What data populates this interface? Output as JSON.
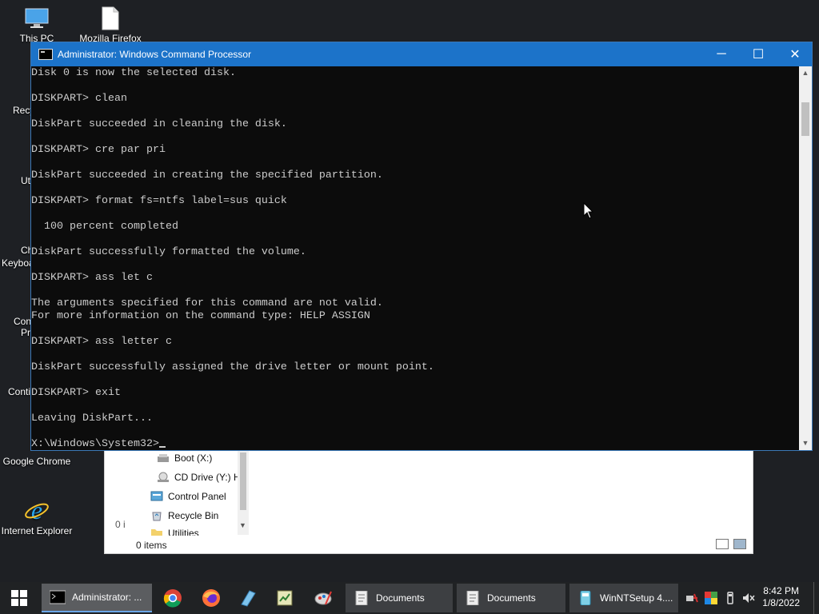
{
  "desktop": {
    "icons": [
      {
        "label": "This PC",
        "icon": "this-pc-icon"
      },
      {
        "label": "Mozilla Firefox",
        "icon": "file-icon"
      },
      {
        "label": "Google Chrome",
        "icon": "chrome-icon"
      },
      {
        "label": "Internet Explorer",
        "icon": "ie-icon"
      }
    ],
    "partial_labels": [
      "Recy",
      "Ut",
      "Ch",
      "Keyboa",
      "Con",
      "Pr",
      "Conti"
    ]
  },
  "explorer": {
    "nav_items": [
      {
        "label": "Boot (X:)",
        "icon": "drive-icon"
      },
      {
        "label": "CD Drive (Y:) H",
        "icon": "cd-drive-icon"
      },
      {
        "label": "Control Panel",
        "icon": "control-panel-icon"
      },
      {
        "label": "Recycle Bin",
        "icon": "recycle-bin-icon"
      },
      {
        "label": "Utilities",
        "icon": "folder-icon"
      }
    ],
    "left_hint": "0 i",
    "status": "0 items"
  },
  "console": {
    "title": "Administrator: Windows Command Processor",
    "lines": [
      "Disk 0 is now the selected disk.",
      "",
      "DISKPART> clean",
      "",
      "DiskPart succeeded in cleaning the disk.",
      "",
      "DISKPART> cre par pri",
      "",
      "DiskPart succeeded in creating the specified partition.",
      "",
      "DISKPART> format fs=ntfs label=sus quick",
      "",
      "  100 percent completed",
      "",
      "DiskPart successfully formatted the volume.",
      "",
      "DISKPART> ass let c",
      "",
      "The arguments specified for this command are not valid.",
      "For more information on the command type: HELP ASSIGN",
      "",
      "DISKPART> ass letter c",
      "",
      "DiskPart successfully assigned the drive letter or mount point.",
      "",
      "DISKPART> exit",
      "",
      "Leaving DiskPart...",
      ""
    ],
    "prompt": "X:\\Windows\\System32>",
    "controls": {
      "minimize": "─",
      "maximize": "☐",
      "close": "✕"
    }
  },
  "taskbar": {
    "tasks": [
      {
        "label": "Administrator: ...",
        "icon": "cmd-icon",
        "active": true
      },
      {
        "label": "Documents",
        "icon": "document-icon",
        "active": false
      },
      {
        "label": "Documents",
        "icon": "document-icon",
        "active": false
      },
      {
        "label": "WinNTSetup 4....",
        "icon": "winntsetup-icon",
        "active": false
      }
    ],
    "pinned": [
      "chrome-icon",
      "firefox-icon",
      "notepad-icon",
      "spreadsheet-icon",
      "paint-icon"
    ],
    "tray_icons": [
      "network-icon",
      "color-icon",
      "usb-icon",
      "volume-icon"
    ],
    "time": "8:42 PM",
    "date": "1/8/2022"
  },
  "colors": {
    "titlebar": "#1c73c9",
    "console_bg": "#0c0c0c",
    "console_text": "#cccccc",
    "taskbar": "#202224"
  }
}
